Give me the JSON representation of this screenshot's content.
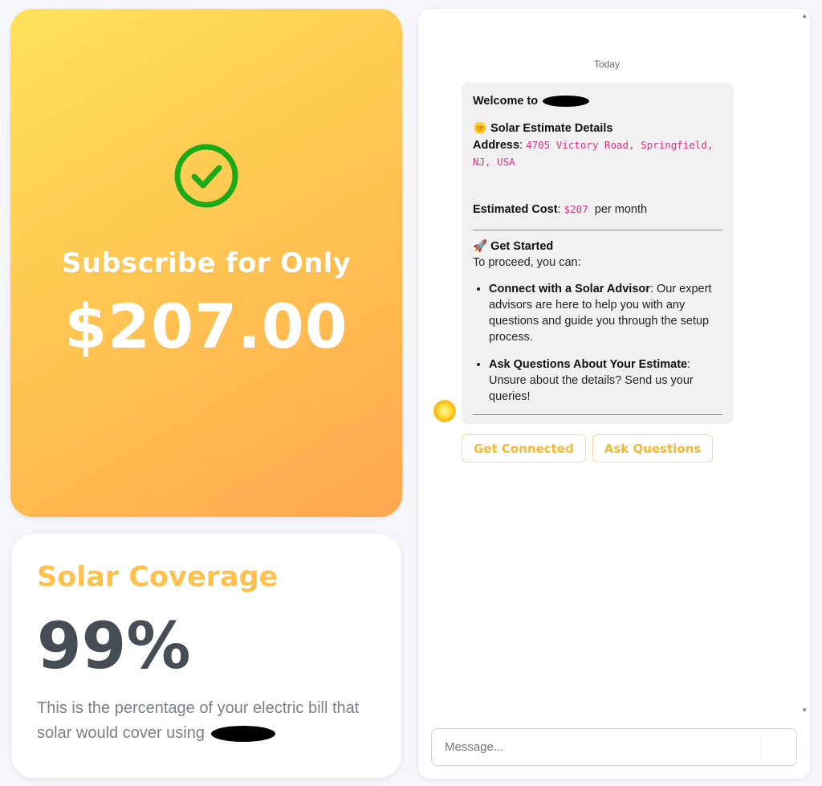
{
  "subscribe": {
    "title": "Subscribe for Only",
    "price": "$207.00",
    "icon": "check-circle-icon",
    "check_color": "#1aaa1a"
  },
  "coverage": {
    "title": "Solar Coverage",
    "value": "99%",
    "description": "This is the percentage of your electric bill that solar would cover using"
  },
  "chat": {
    "date_label": "Today",
    "avatar_icon": "sun-icon",
    "message": {
      "welcome": "Welcome to",
      "estimate_emoji": "🌞",
      "estimate_heading": "Solar Estimate Details",
      "address_label": "Address",
      "address_value": "4705 Victory Road, Springfield, NJ, USA",
      "cost_label": "Estimated Cost",
      "cost_value": "$207",
      "cost_suffix": "per month",
      "started_emoji": "🚀",
      "started_heading": "Get Started",
      "started_intro": "To proceed, you can:",
      "options": [
        {
          "title": "Connect with a Solar Advisor",
          "text": "Our expert advisors are here to help you with any questions and guide you through the setup process."
        },
        {
          "title": "Ask Questions About Your Estimate",
          "text": "Unsure about the details? Send us your queries!"
        }
      ]
    },
    "quick_replies": [
      "Get Connected",
      "Ask Questions"
    ],
    "input_placeholder": "Message..."
  },
  "colors": {
    "accent": "#ffc04d",
    "card_gradient_start": "#ffe259",
    "card_gradient_end": "#ffa74f",
    "coverage_value": "#474d55",
    "code_text": "#d63384"
  }
}
